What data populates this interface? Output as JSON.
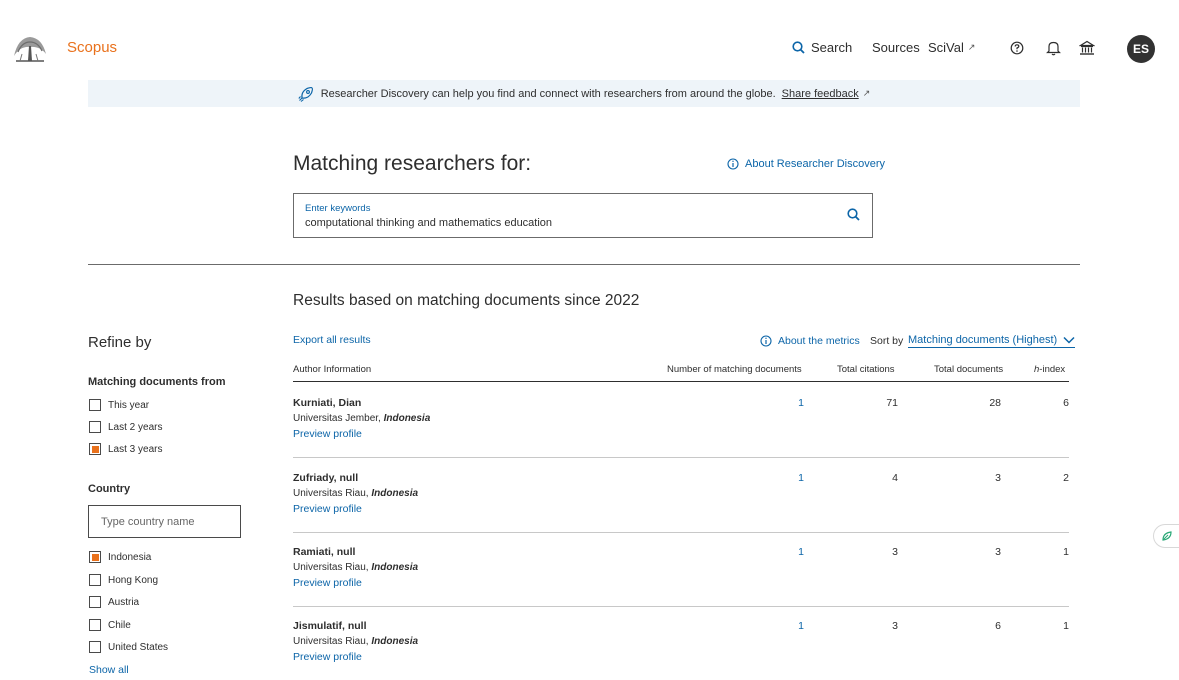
{
  "nav": {
    "brand": "Scopus",
    "search": "Search",
    "sources": "Sources",
    "scival": "SciVal",
    "external_glyph": "↗",
    "avatar_initials": "ES"
  },
  "banner": {
    "text": "Researcher Discovery can help you find and connect with researchers from around the globe.",
    "link": "Share feedback"
  },
  "header": {
    "title": "Matching researchers for:",
    "about_link": "About Researcher Discovery"
  },
  "search": {
    "label": "Enter keywords",
    "value": "computational thinking and mathematics education"
  },
  "results_title": "Results based on matching documents since 2022",
  "sidebar": {
    "refine_title": "Refine by",
    "matching_title": "Matching documents from",
    "matching_options": [
      {
        "label": "This year",
        "checked": false
      },
      {
        "label": "Last 2 years",
        "checked": false
      },
      {
        "label": "Last 3 years",
        "checked": true
      }
    ],
    "country_title": "Country",
    "country_placeholder": "Type country name",
    "countries": [
      {
        "label": "Indonesia",
        "checked": true
      },
      {
        "label": "Hong Kong",
        "checked": false
      },
      {
        "label": "Austria",
        "checked": false
      },
      {
        "label": "Chile",
        "checked": false
      },
      {
        "label": "United States",
        "checked": false
      }
    ],
    "show_all": "Show all"
  },
  "toolbar": {
    "export": "Export all results",
    "about_metrics": "About the metrics",
    "sort_label": "Sort by",
    "sort_value": "Matching documents (Highest)"
  },
  "columns": {
    "author": "Author Information",
    "matching": "Number of matching documents",
    "citations": "Total citations",
    "documents": "Total documents",
    "h_prefix": "h",
    "h_suffix": "-index"
  },
  "rows": [
    {
      "name": "Kurniati, Dian",
      "institution": "Universitas Jember, ",
      "country": "Indonesia",
      "preview": "Preview profile",
      "matching": "1",
      "citations": "71",
      "documents": "28",
      "h": "6"
    },
    {
      "name": "Zufriady, null",
      "institution": "Universitas Riau, ",
      "country": "Indonesia",
      "preview": "Preview profile",
      "matching": "1",
      "citations": "4",
      "documents": "3",
      "h": "2"
    },
    {
      "name": "Ramiati, null",
      "institution": "Universitas Riau, ",
      "country": "Indonesia",
      "preview": "Preview profile",
      "matching": "1",
      "citations": "3",
      "documents": "3",
      "h": "1"
    },
    {
      "name": "Jismulatif, null",
      "institution": "Universitas Riau, ",
      "country": "Indonesia",
      "preview": "Preview profile",
      "matching": "1",
      "citations": "3",
      "documents": "6",
      "h": "1"
    }
  ],
  "colors": {
    "accent": "#e9711c",
    "link": "#0c65a8",
    "banner_bg": "#eef4f9"
  }
}
